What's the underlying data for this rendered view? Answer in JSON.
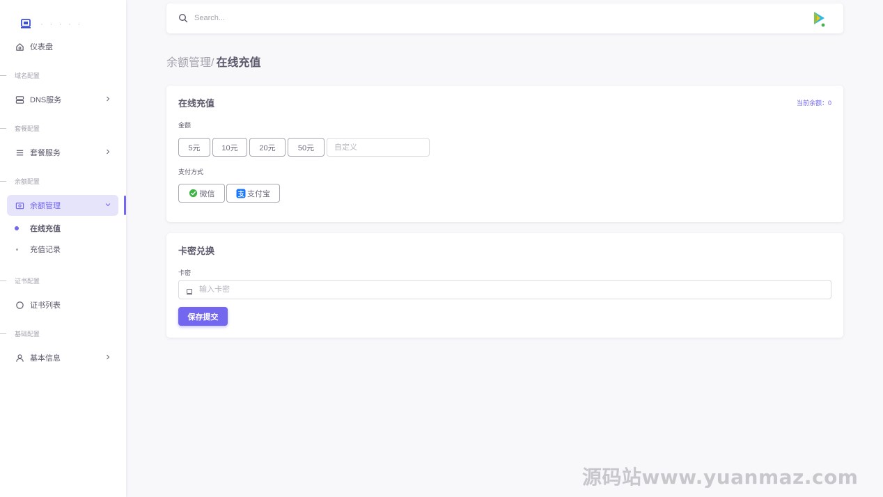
{
  "brand": {
    "name": "· · · · ·"
  },
  "sidebar": {
    "dashboard": "仪表盘",
    "sections": [
      "域名配置",
      "套餐配置",
      "余额配置",
      "证书配置",
      "基础配置"
    ],
    "dns": "DNS服务",
    "package": "套餐服务",
    "balance_mgmt": "余额管理",
    "sub_items": [
      "在线充值",
      "充值记录"
    ],
    "cert_list": "证书列表",
    "basic_info": "基本信息"
  },
  "search": {
    "placeholder": "Search..."
  },
  "breadcrumb": {
    "parent": "余额管理/",
    "current": "在线充值"
  },
  "recharge": {
    "title": "在线充值",
    "balance": "当前余额：0",
    "amount_label": "金额",
    "amounts": [
      "5元",
      "10元",
      "20元",
      "50元"
    ],
    "custom_placeholder": "自定义",
    "pay_label": "支付方式",
    "pay_methods": [
      "微信",
      "支付宝"
    ]
  },
  "redeem": {
    "title": "卡密兑换",
    "card_label": "卡密",
    "card_placeholder": "输入卡密",
    "submit": "保存提交"
  },
  "watermark": "源码站www.yuanmaz.com",
  "colors": {
    "primary": "#7367f0",
    "background": "#f8f7fa",
    "wechat": "#3fb444",
    "alipay": "#1677ff"
  }
}
